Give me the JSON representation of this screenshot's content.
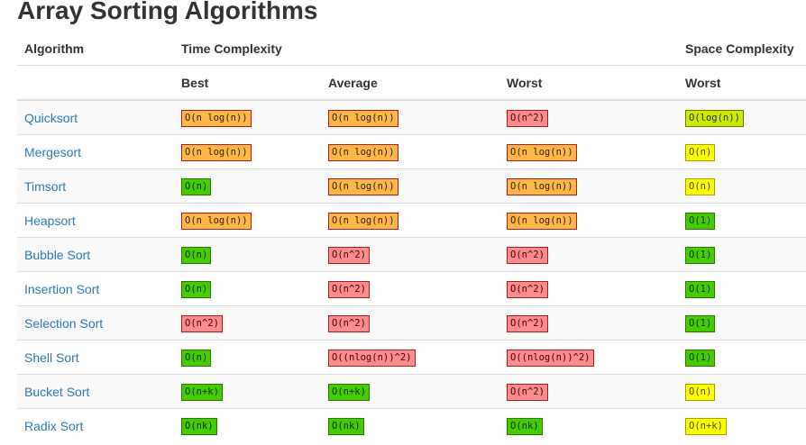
{
  "page": {
    "title": "Array Sorting Algorithms"
  },
  "header": {
    "algorithm": "Algorithm",
    "time_complexity": "Time Complexity",
    "space_complexity": "Space Complexity",
    "best": "Best",
    "average": "Average",
    "worst": "Worst",
    "space_worst": "Worst"
  },
  "colors": {
    "orange": "#ffb847",
    "red": "#ff8c8c",
    "green": "#44cc00",
    "lime": "#cbea00",
    "yellow": "#ffff00",
    "link": "#2a7ab5"
  },
  "rows": [
    {
      "name": "Quicksort",
      "best": {
        "text": "O(n log(n))",
        "color": "orange"
      },
      "average": {
        "text": "O(n log(n))",
        "color": "orange"
      },
      "worst": {
        "text": "O(n^2)",
        "color": "red"
      },
      "space": {
        "text": "O(log(n))",
        "color": "lime"
      }
    },
    {
      "name": "Mergesort",
      "best": {
        "text": "O(n log(n))",
        "color": "orange"
      },
      "average": {
        "text": "O(n log(n))",
        "color": "orange"
      },
      "worst": {
        "text": "O(n log(n))",
        "color": "orange"
      },
      "space": {
        "text": "O(n)",
        "color": "yellow"
      }
    },
    {
      "name": "Timsort",
      "best": {
        "text": "O(n)",
        "color": "green"
      },
      "average": {
        "text": "O(n log(n))",
        "color": "orange"
      },
      "worst": {
        "text": "O(n log(n))",
        "color": "orange"
      },
      "space": {
        "text": "O(n)",
        "color": "yellow"
      }
    },
    {
      "name": "Heapsort",
      "best": {
        "text": "O(n log(n))",
        "color": "orange"
      },
      "average": {
        "text": "O(n log(n))",
        "color": "orange"
      },
      "worst": {
        "text": "O(n log(n))",
        "color": "orange"
      },
      "space": {
        "text": "O(1)",
        "color": "green"
      }
    },
    {
      "name": "Bubble Sort",
      "best": {
        "text": "O(n)",
        "color": "green"
      },
      "average": {
        "text": "O(n^2)",
        "color": "red"
      },
      "worst": {
        "text": "O(n^2)",
        "color": "red"
      },
      "space": {
        "text": "O(1)",
        "color": "green"
      }
    },
    {
      "name": "Insertion Sort",
      "best": {
        "text": "O(n)",
        "color": "green"
      },
      "average": {
        "text": "O(n^2)",
        "color": "red"
      },
      "worst": {
        "text": "O(n^2)",
        "color": "red"
      },
      "space": {
        "text": "O(1)",
        "color": "green"
      }
    },
    {
      "name": "Selection Sort",
      "best": {
        "text": "O(n^2)",
        "color": "red"
      },
      "average": {
        "text": "O(n^2)",
        "color": "red"
      },
      "worst": {
        "text": "O(n^2)",
        "color": "red"
      },
      "space": {
        "text": "O(1)",
        "color": "green"
      }
    },
    {
      "name": "Shell Sort",
      "best": {
        "text": "O(n)",
        "color": "green"
      },
      "average": {
        "text": "O((nlog(n))^2)",
        "color": "red"
      },
      "worst": {
        "text": "O((nlog(n))^2)",
        "color": "red"
      },
      "space": {
        "text": "O(1)",
        "color": "green"
      }
    },
    {
      "name": "Bucket Sort",
      "best": {
        "text": "O(n+k)",
        "color": "green"
      },
      "average": {
        "text": "O(n+k)",
        "color": "green"
      },
      "worst": {
        "text": "O(n^2)",
        "color": "red"
      },
      "space": {
        "text": "O(n)",
        "color": "yellow"
      }
    },
    {
      "name": "Radix Sort",
      "best": {
        "text": "O(nk)",
        "color": "green"
      },
      "average": {
        "text": "O(nk)",
        "color": "green"
      },
      "worst": {
        "text": "O(nk)",
        "color": "green"
      },
      "space": {
        "text": "O(n+k)",
        "color": "yellow"
      }
    }
  ]
}
